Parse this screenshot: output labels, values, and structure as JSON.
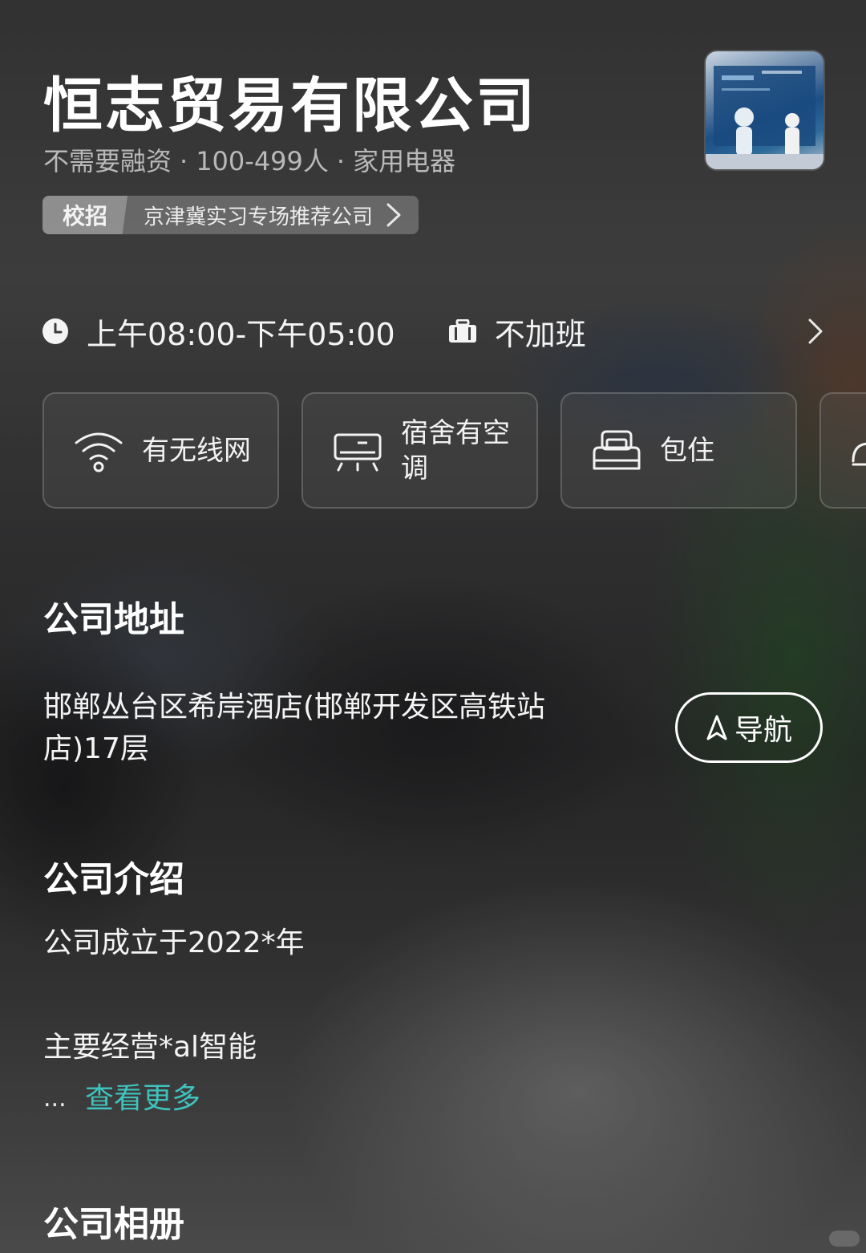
{
  "company": {
    "name": "恒志贸易有限公司",
    "funding": "不需要融资",
    "size": "100-499人",
    "industry": "家用电器",
    "separator": "·"
  },
  "campus_tag": {
    "badge": "校招",
    "text": "京津冀实习专场推荐公司"
  },
  "work_time": {
    "hours": "上午08:00-下午05:00",
    "overtime": "不加班"
  },
  "benefits": [
    {
      "label": "有无线网",
      "icon": "wifi-icon"
    },
    {
      "label": "宿舍有空调",
      "icon": "air-conditioner-icon"
    },
    {
      "label": "包住",
      "icon": "bed-icon"
    }
  ],
  "address": {
    "title": "公司地址",
    "text": "邯郸丛台区希岸酒店(邯郸开发区高铁站店)17层",
    "nav_label": "导航"
  },
  "intro": {
    "title": "公司介绍",
    "line1": "公司成立于2022*年",
    "line2": "主要经营*al智能",
    "ellipsis": "...",
    "more": "查看更多"
  },
  "album": {
    "title": "公司相册"
  },
  "colors": {
    "link": "#3fc3be",
    "text": "#f4f4f4",
    "muted": "#b9b9b9"
  }
}
